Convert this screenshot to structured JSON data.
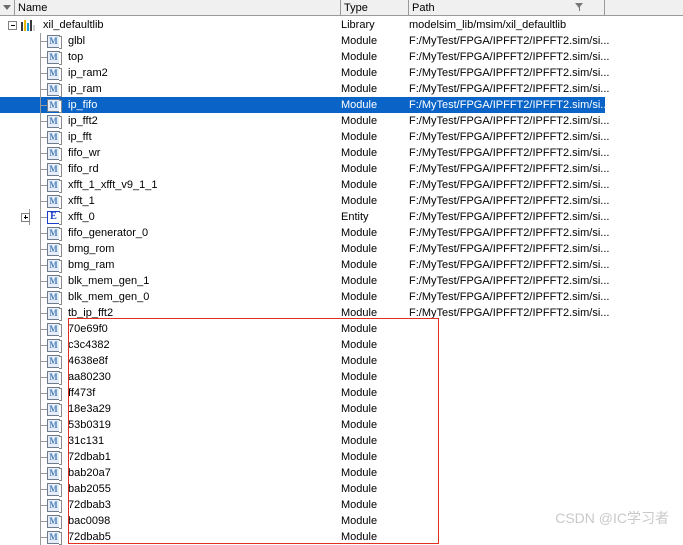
{
  "header": {
    "filter_icon": "funnel-icon",
    "columns": [
      {
        "label": "Name",
        "key": "name"
      },
      {
        "label": "Type",
        "key": "type"
      },
      {
        "label": "Path",
        "key": "path",
        "filter_icon": "funnel-icon"
      }
    ]
  },
  "watermark": "CSDN @IC学习者",
  "tree": {
    "root": {
      "name": "xil_defaultlib",
      "type": "Library",
      "path": "modelsim_lib/msim/xil_defaultlib",
      "icon": "library-icon",
      "expander": "minus",
      "selected": false
    },
    "truncated_path": "F:/MyTest/FPGA/IPFFT2/IPFFT2.sim/si...",
    "children": [
      {
        "name": "glbl",
        "type": "Module",
        "path": "F:/MyTest/FPGA/IPFFT2/IPFFT2.sim/si...",
        "icon": "module-icon",
        "expander": "none",
        "selected": false,
        "in_annotation": false
      },
      {
        "name": "top",
        "type": "Module",
        "path": "F:/MyTest/FPGA/IPFFT2/IPFFT2.sim/si...",
        "icon": "module-icon",
        "expander": "none",
        "selected": false,
        "in_annotation": false
      },
      {
        "name": "ip_ram2",
        "type": "Module",
        "path": "F:/MyTest/FPGA/IPFFT2/IPFFT2.sim/si...",
        "icon": "module-icon",
        "expander": "none",
        "selected": false,
        "in_annotation": false
      },
      {
        "name": "ip_ram",
        "type": "Module",
        "path": "F:/MyTest/FPGA/IPFFT2/IPFFT2.sim/si...",
        "icon": "module-icon",
        "expander": "none",
        "selected": false,
        "in_annotation": false
      },
      {
        "name": "ip_fifo",
        "type": "Module",
        "path": "F:/MyTest/FPGA/IPFFT2/IPFFT2.sim/si...",
        "icon": "module-icon",
        "expander": "none",
        "selected": true,
        "in_annotation": false
      },
      {
        "name": "ip_fft2",
        "type": "Module",
        "path": "F:/MyTest/FPGA/IPFFT2/IPFFT2.sim/si...",
        "icon": "module-icon",
        "expander": "none",
        "selected": false,
        "in_annotation": false
      },
      {
        "name": "ip_fft",
        "type": "Module",
        "path": "F:/MyTest/FPGA/IPFFT2/IPFFT2.sim/si...",
        "icon": "module-icon",
        "expander": "none",
        "selected": false,
        "in_annotation": false
      },
      {
        "name": "fifo_wr",
        "type": "Module",
        "path": "F:/MyTest/FPGA/IPFFT2/IPFFT2.sim/si...",
        "icon": "module-icon",
        "expander": "none",
        "selected": false,
        "in_annotation": false
      },
      {
        "name": "fifo_rd",
        "type": "Module",
        "path": "F:/MyTest/FPGA/IPFFT2/IPFFT2.sim/si...",
        "icon": "module-icon",
        "expander": "none",
        "selected": false,
        "in_annotation": false
      },
      {
        "name": "xfft_1_xfft_v9_1_1",
        "type": "Module",
        "path": "F:/MyTest/FPGA/IPFFT2/IPFFT2.sim/si...",
        "icon": "module-icon",
        "expander": "none",
        "selected": false,
        "in_annotation": false
      },
      {
        "name": "xfft_1",
        "type": "Module",
        "path": "F:/MyTest/FPGA/IPFFT2/IPFFT2.sim/si...",
        "icon": "module-icon",
        "expander": "none",
        "selected": false,
        "in_annotation": false
      },
      {
        "name": "xfft_0",
        "type": "Entity",
        "path": "F:/MyTest/FPGA/IPFFT2/IPFFT2.sim/si...",
        "icon": "entity-icon",
        "expander": "plus",
        "selected": false,
        "in_annotation": false
      },
      {
        "name": "fifo_generator_0",
        "type": "Module",
        "path": "F:/MyTest/FPGA/IPFFT2/IPFFT2.sim/si...",
        "icon": "module-icon",
        "expander": "none",
        "selected": false,
        "in_annotation": false
      },
      {
        "name": "bmg_rom",
        "type": "Module",
        "path": "F:/MyTest/FPGA/IPFFT2/IPFFT2.sim/si...",
        "icon": "module-icon",
        "expander": "none",
        "selected": false,
        "in_annotation": false
      },
      {
        "name": "bmg_ram",
        "type": "Module",
        "path": "F:/MyTest/FPGA/IPFFT2/IPFFT2.sim/si...",
        "icon": "module-icon",
        "expander": "none",
        "selected": false,
        "in_annotation": false
      },
      {
        "name": "blk_mem_gen_1",
        "type": "Module",
        "path": "F:/MyTest/FPGA/IPFFT2/IPFFT2.sim/si...",
        "icon": "module-icon",
        "expander": "none",
        "selected": false,
        "in_annotation": false
      },
      {
        "name": "blk_mem_gen_0",
        "type": "Module",
        "path": "F:/MyTest/FPGA/IPFFT2/IPFFT2.sim/si...",
        "icon": "module-icon",
        "expander": "none",
        "selected": false,
        "in_annotation": false
      },
      {
        "name": "tb_ip_fft2",
        "type": "Module",
        "path": "F:/MyTest/FPGA/IPFFT2/IPFFT2.sim/si...",
        "icon": "module-icon",
        "expander": "none",
        "selected": false,
        "in_annotation": false
      },
      {
        "name": "70e69f0",
        "type": "Module",
        "path": "",
        "icon": "module-icon",
        "expander": "none",
        "selected": false,
        "in_annotation": true
      },
      {
        "name": "c3c4382",
        "type": "Module",
        "path": "",
        "icon": "module-icon",
        "expander": "none",
        "selected": false,
        "in_annotation": true
      },
      {
        "name": "4638e8f",
        "type": "Module",
        "path": "",
        "icon": "module-icon",
        "expander": "none",
        "selected": false,
        "in_annotation": true
      },
      {
        "name": "aa80230",
        "type": "Module",
        "path": "",
        "icon": "module-icon",
        "expander": "none",
        "selected": false,
        "in_annotation": true
      },
      {
        "name": "ff473f",
        "type": "Module",
        "path": "",
        "icon": "module-icon",
        "expander": "none",
        "selected": false,
        "in_annotation": true
      },
      {
        "name": "18e3a29",
        "type": "Module",
        "path": "",
        "icon": "module-icon",
        "expander": "none",
        "selected": false,
        "in_annotation": true
      },
      {
        "name": "53b0319",
        "type": "Module",
        "path": "",
        "icon": "module-icon",
        "expander": "none",
        "selected": false,
        "in_annotation": true
      },
      {
        "name": "31c131",
        "type": "Module",
        "path": "",
        "icon": "module-icon",
        "expander": "none",
        "selected": false,
        "in_annotation": true
      },
      {
        "name": "72dbab1",
        "type": "Module",
        "path": "",
        "icon": "module-icon",
        "expander": "none",
        "selected": false,
        "in_annotation": true
      },
      {
        "name": "bab20a7",
        "type": "Module",
        "path": "",
        "icon": "module-icon",
        "expander": "none",
        "selected": false,
        "in_annotation": true
      },
      {
        "name": "bab2055",
        "type": "Module",
        "path": "",
        "icon": "module-icon",
        "expander": "none",
        "selected": false,
        "in_annotation": true
      },
      {
        "name": "72dbab3",
        "type": "Module",
        "path": "",
        "icon": "module-icon",
        "expander": "none",
        "selected": false,
        "in_annotation": true
      },
      {
        "name": "bac0098",
        "type": "Module",
        "path": "",
        "icon": "module-icon",
        "expander": "none",
        "selected": false,
        "in_annotation": true
      },
      {
        "name": "72dbab5",
        "type": "Module",
        "path": "",
        "icon": "module-icon",
        "expander": "none",
        "selected": false,
        "in_annotation": true
      }
    ]
  },
  "colors": {
    "selection": "#0a64c8",
    "annotation": "#e03020",
    "header_bg": "#f0f0f0",
    "grid_line": "#9a9a9a",
    "watermark": "#c9c9c9"
  }
}
